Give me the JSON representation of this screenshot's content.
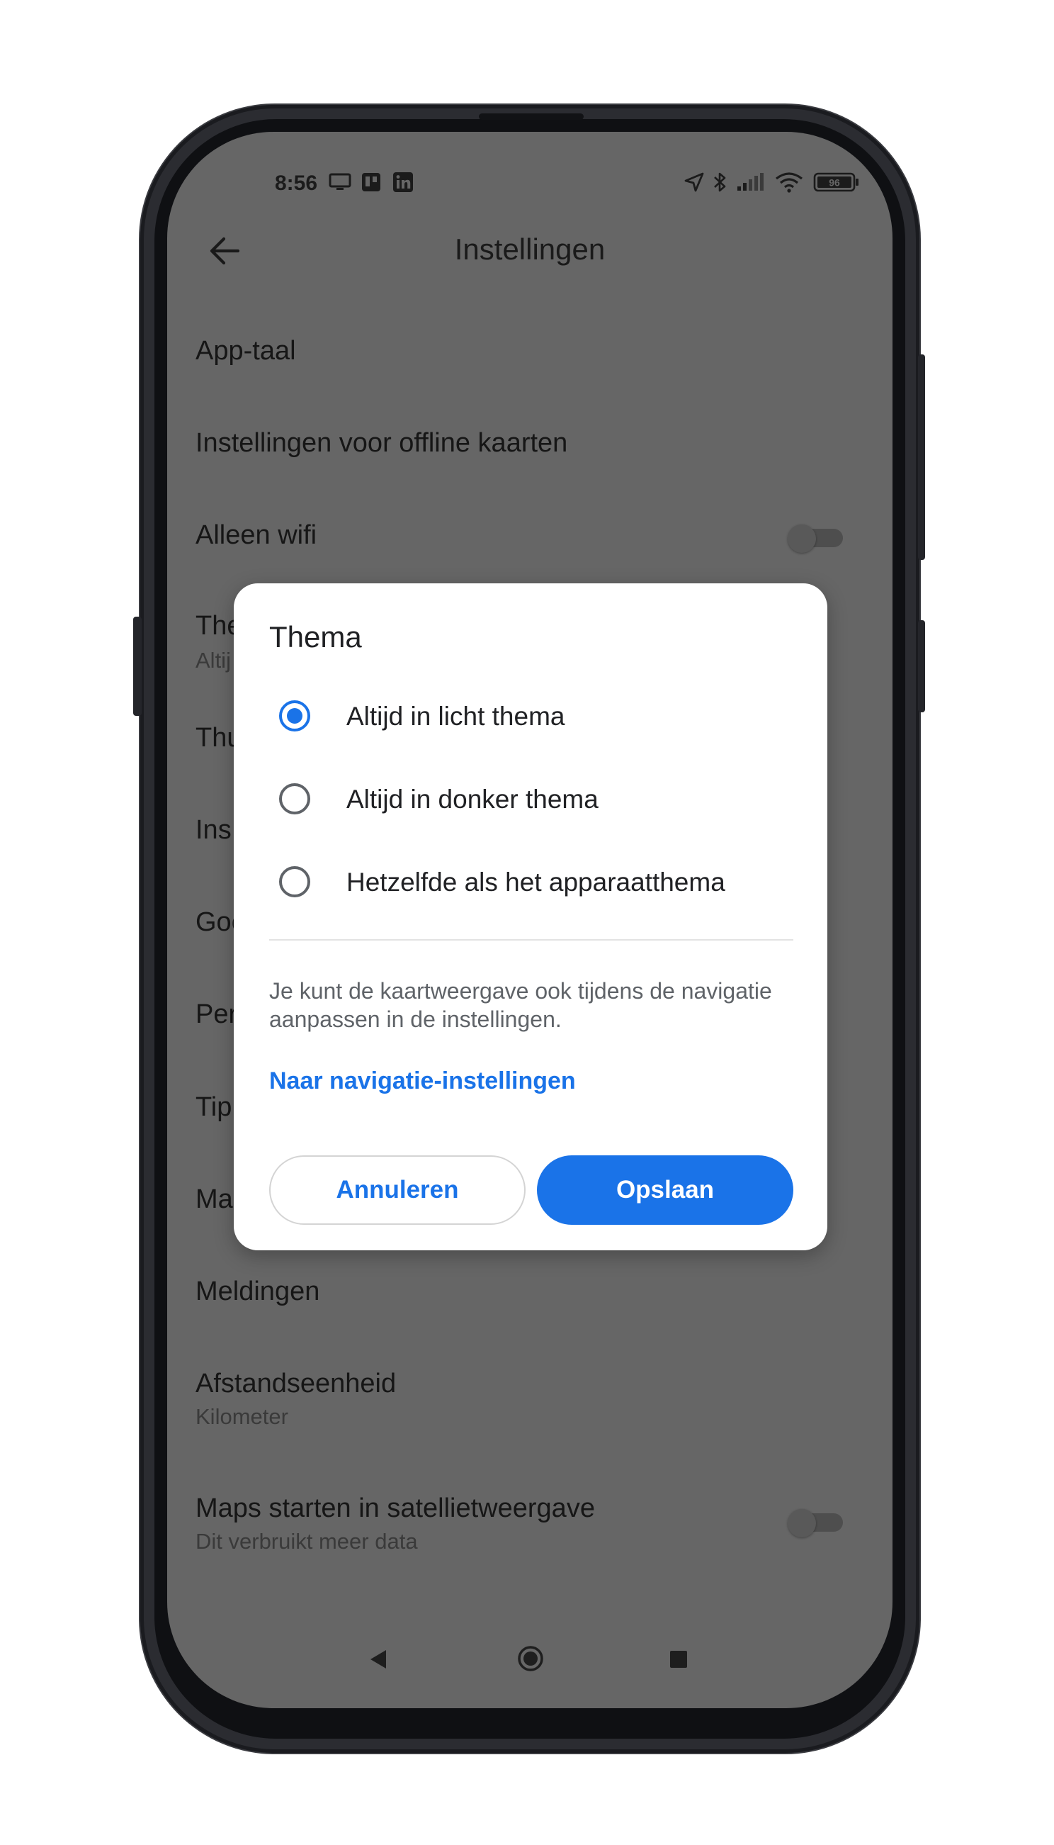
{
  "status_bar": {
    "time": "8:56",
    "battery": "96",
    "left_icons": [
      "monitor-icon",
      "trello-icon",
      "linkedin-icon"
    ],
    "right_icons": [
      "location-arrow-icon",
      "bluetooth-icon",
      "cell-signal-icon",
      "wifi-icon",
      "battery-icon"
    ]
  },
  "app_bar": {
    "title": "Instellingen",
    "back_icon": "arrow-back-icon"
  },
  "settings": {
    "app_language": "App-taal",
    "offline_maps": "Instellingen voor offline kaarten",
    "wifi_only": {
      "label": "Alleen wifi",
      "enabled": false
    },
    "theme_partial": {
      "label": "The",
      "sub": "Altij"
    },
    "home_partial": "Thu",
    "ins_partial": "Ins",
    "goo_partial": "Goo",
    "per_partial": "Per",
    "tips_partial": "Tip",
    "maps_partial": "Ma",
    "notifications": "Meldingen",
    "distance_unit": {
      "label": "Afstandseenheid",
      "value": "Kilometer"
    },
    "satellite_start": {
      "label": "Maps starten in satellietweergave",
      "sub": "Dit verbruikt meer data",
      "enabled": false
    }
  },
  "dialog": {
    "title": "Thema",
    "options": [
      {
        "label": "Altijd in licht thema",
        "selected": true
      },
      {
        "label": "Altijd in donker thema",
        "selected": false
      },
      {
        "label": "Hetzelfde als het apparaatthema",
        "selected": false
      }
    ],
    "info": "Je kunt de kaartweergave ook tijdens de navigatie aanpassen in de instellingen.",
    "link": "Naar navigatie-instellingen",
    "cancel": "Annuleren",
    "save": "Opslaan"
  },
  "nav_bar": [
    "back-triangle-icon",
    "home-circle-icon",
    "recents-square-icon"
  ],
  "colors": {
    "accent": "#1a73e8",
    "scrim_background": "#666666",
    "dialog_background": "#ffffff"
  }
}
